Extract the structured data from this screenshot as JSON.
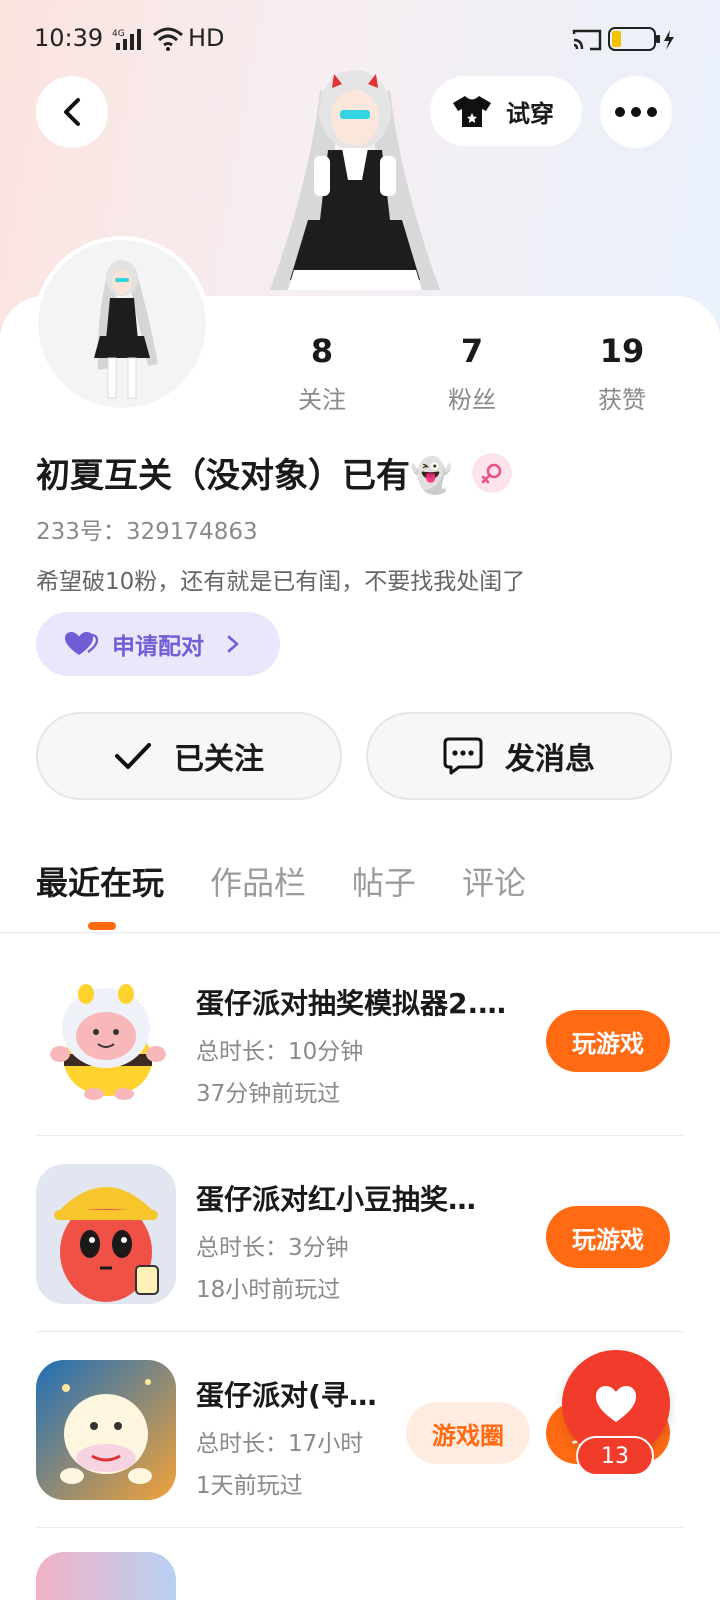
{
  "status_bar": {
    "time": "10:39",
    "network": "4G",
    "hd": "HD"
  },
  "nav": {
    "tryon_label": "试穿"
  },
  "stats": [
    {
      "value": "8",
      "label": "关注"
    },
    {
      "value": "7",
      "label": "粉丝"
    },
    {
      "value": "19",
      "label": "获赞"
    }
  ],
  "profile": {
    "nickname": "初夏互关（没对象）已有",
    "nickname_emoji": "👻",
    "uid": "233号：329174863",
    "bio": "希望破10粉，还有就是已有闺，不要找我处闺了",
    "pair_label": "申请配对"
  },
  "actions": {
    "follow_label": "已关注",
    "message_label": "发消息"
  },
  "tabs": [
    {
      "label": "最近在玩",
      "active": true
    },
    {
      "label": "作品栏",
      "active": false
    },
    {
      "label": "帖子",
      "active": false
    },
    {
      "label": "评论",
      "active": false
    }
  ],
  "games": [
    {
      "title": "蛋仔派对抽奖模拟器2.…",
      "duration": "总时长：10分钟",
      "last_played": "37分钟前玩过",
      "action": "玩游戏"
    },
    {
      "title": " 蛋仔派对红小豆抽奖…",
      "duration": "总时长：3分钟",
      "last_played": "18小时前玩过",
      "action": "玩游戏"
    },
    {
      "title": "蛋仔派对(寻…",
      "duration": "总时长：17小时",
      "last_played": "1天前玩过",
      "circle": "游戏圈",
      "action": "玩游戏"
    }
  ],
  "like": {
    "count": "13"
  },
  "colors": {
    "accent_orange": "#ff6a13",
    "like_red": "#f23c2b",
    "pair_purple": "#6f5ed6"
  }
}
